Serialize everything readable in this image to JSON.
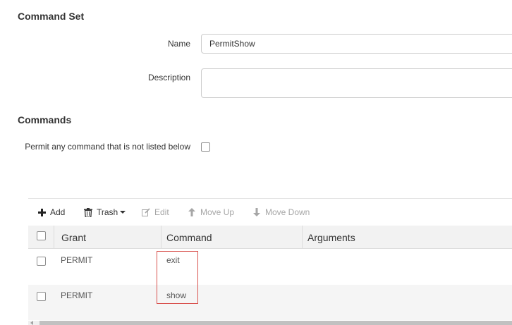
{
  "command_set": {
    "title": "Command Set",
    "name_label": "Name",
    "name_value": "PermitShow",
    "description_label": "Description",
    "description_value": ""
  },
  "commands": {
    "title": "Commands",
    "permit_any_label": "Permit any command that is not listed below",
    "permit_any_checked": false
  },
  "toolbar": {
    "add_label": "Add",
    "trash_label": "Trash",
    "edit_label": "Edit",
    "move_up_label": "Move Up",
    "move_down_label": "Move Down"
  },
  "grid": {
    "columns": [
      "Grant",
      "Command",
      "Arguments"
    ],
    "rows": [
      {
        "grant": "PERMIT",
        "command": "exit",
        "arguments": ""
      },
      {
        "grant": "PERMIT",
        "command": "show",
        "arguments": ""
      }
    ]
  },
  "colors": {
    "highlight": "#d9534f",
    "header_bg": "#f2f2f2",
    "alt_row_bg": "#f5f5f5"
  }
}
